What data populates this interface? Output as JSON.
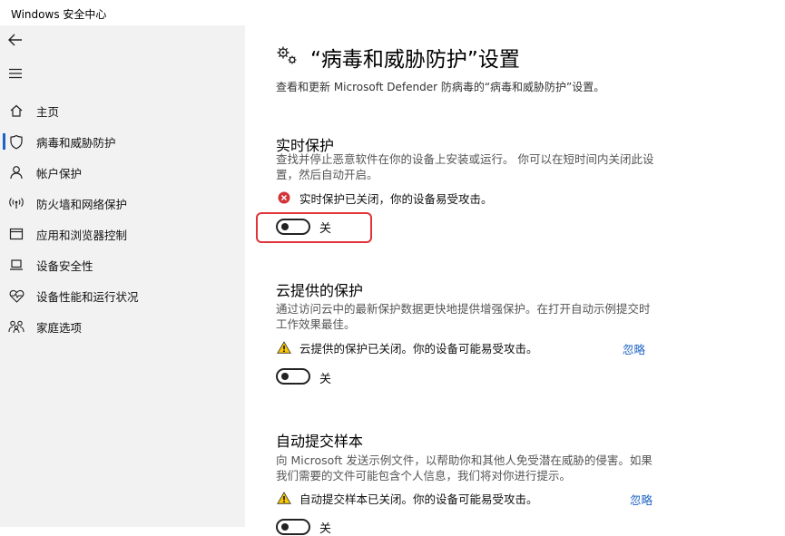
{
  "window": {
    "title": "Windows 安全中心"
  },
  "sidebar": {
    "items": [
      {
        "label": "主页",
        "icon": "home-icon"
      },
      {
        "label": "病毒和威胁防护",
        "icon": "shield-icon",
        "active": true
      },
      {
        "label": "帐户保护",
        "icon": "person-icon"
      },
      {
        "label": "防火墙和网络保护",
        "icon": "wifi-antenna-icon"
      },
      {
        "label": "应用和浏览器控制",
        "icon": "app-window-icon"
      },
      {
        "label": "设备安全性",
        "icon": "laptop-icon"
      },
      {
        "label": "设备性能和运行状况",
        "icon": "heart-pulse-icon"
      },
      {
        "label": "家庭选项",
        "icon": "family-icon"
      }
    ]
  },
  "page": {
    "title": "“病毒和威胁防护”设置",
    "subtitle": "查看和更新 Microsoft Defender 防病毒的“病毒和威胁防护”设置。"
  },
  "sections": [
    {
      "title": "实时保护",
      "description": "查找并停止恶意软件在你的设备上安装或运行。 你可以在短时间内关闭此设置，然后自动开启。",
      "status": "实时保护已关闭，你的设备易受攻击。",
      "status_type": "error",
      "dismiss": "",
      "toggle_label": "关"
    },
    {
      "title": "云提供的保护",
      "description": "通过访问云中的最新保护数据更快地提供增强保护。在打开自动示例提交时工作效果最佳。",
      "status": "云提供的保护已关闭。你的设备可能易受攻击。",
      "status_type": "warning",
      "dismiss": "忽略",
      "toggle_label": "关"
    },
    {
      "title": "自动提交样本",
      "description": "向 Microsoft 发送示例文件，以帮助你和其他人免受潜在威胁的侵害。如果我们需要的文件可能包含个人信息，我们将对你进行提示。",
      "status": "自动提交样本已关闭。你的设备可能易受攻击。",
      "status_type": "warning",
      "dismiss": "忽略",
      "toggle_label": "关"
    }
  ],
  "colors": {
    "sidebar_bg": "#f2f2f2",
    "accent": "#1e63c4",
    "error": "#d13438",
    "warning": "#f7c600",
    "highlight": "#e0343a"
  }
}
